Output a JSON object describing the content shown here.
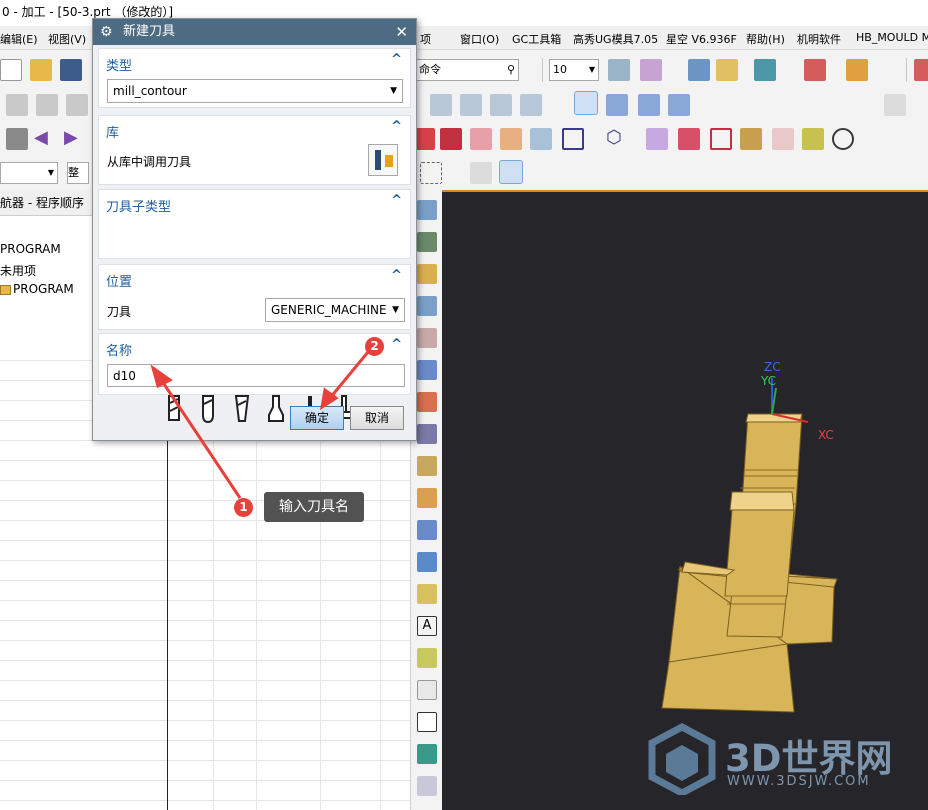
{
  "window": {
    "title": "0 - 加工 - [50-3.prt （修改的）]"
  },
  "menu": {
    "items": [
      "编辑(E)",
      "视图(V)",
      "项",
      "窗口(O)",
      "GC工具箱",
      "高秀UG模具7.05",
      "星空 V6.936F",
      "帮助(H)",
      "机明软件",
      "HB_MOULD M"
    ]
  },
  "toolbar": {
    "command_search_placeholder": "命令",
    "zoom_value": "10",
    "filter_value": "整个"
  },
  "navigator": {
    "title": "航器 - 程序顺序",
    "rows": [
      "PROGRAM",
      "未用项",
      "PROGRAM"
    ]
  },
  "dialog": {
    "title": "新建刀具",
    "sections": {
      "type": {
        "heading": "类型",
        "value": "mill_contour"
      },
      "library": {
        "heading": "库",
        "label": "从库中调用刀具"
      },
      "subtype": {
        "heading": "刀具子类型"
      },
      "location": {
        "heading": "位置",
        "label": "刀具",
        "value": "GENERIC_MACHINE"
      },
      "name": {
        "heading": "名称",
        "value": "d10"
      }
    },
    "ok_label": "确定",
    "cancel_label": "取消"
  },
  "annotations": {
    "badge1": "1",
    "badge2": "2",
    "tooltip": "输入刀具名"
  },
  "viewport": {
    "axis_zc": "ZC",
    "axis_yc": "YC",
    "axis_xc": "XC",
    "watermark_title": "3D世界网",
    "watermark_url": "WWW.3DSJW.COM"
  },
  "colors": {
    "dialog_header": "#4d6b82",
    "section_heading": "#1f5fa0",
    "badge": "#e8403a",
    "model": "#d9b55a",
    "viewport_bg": "#26262a"
  }
}
